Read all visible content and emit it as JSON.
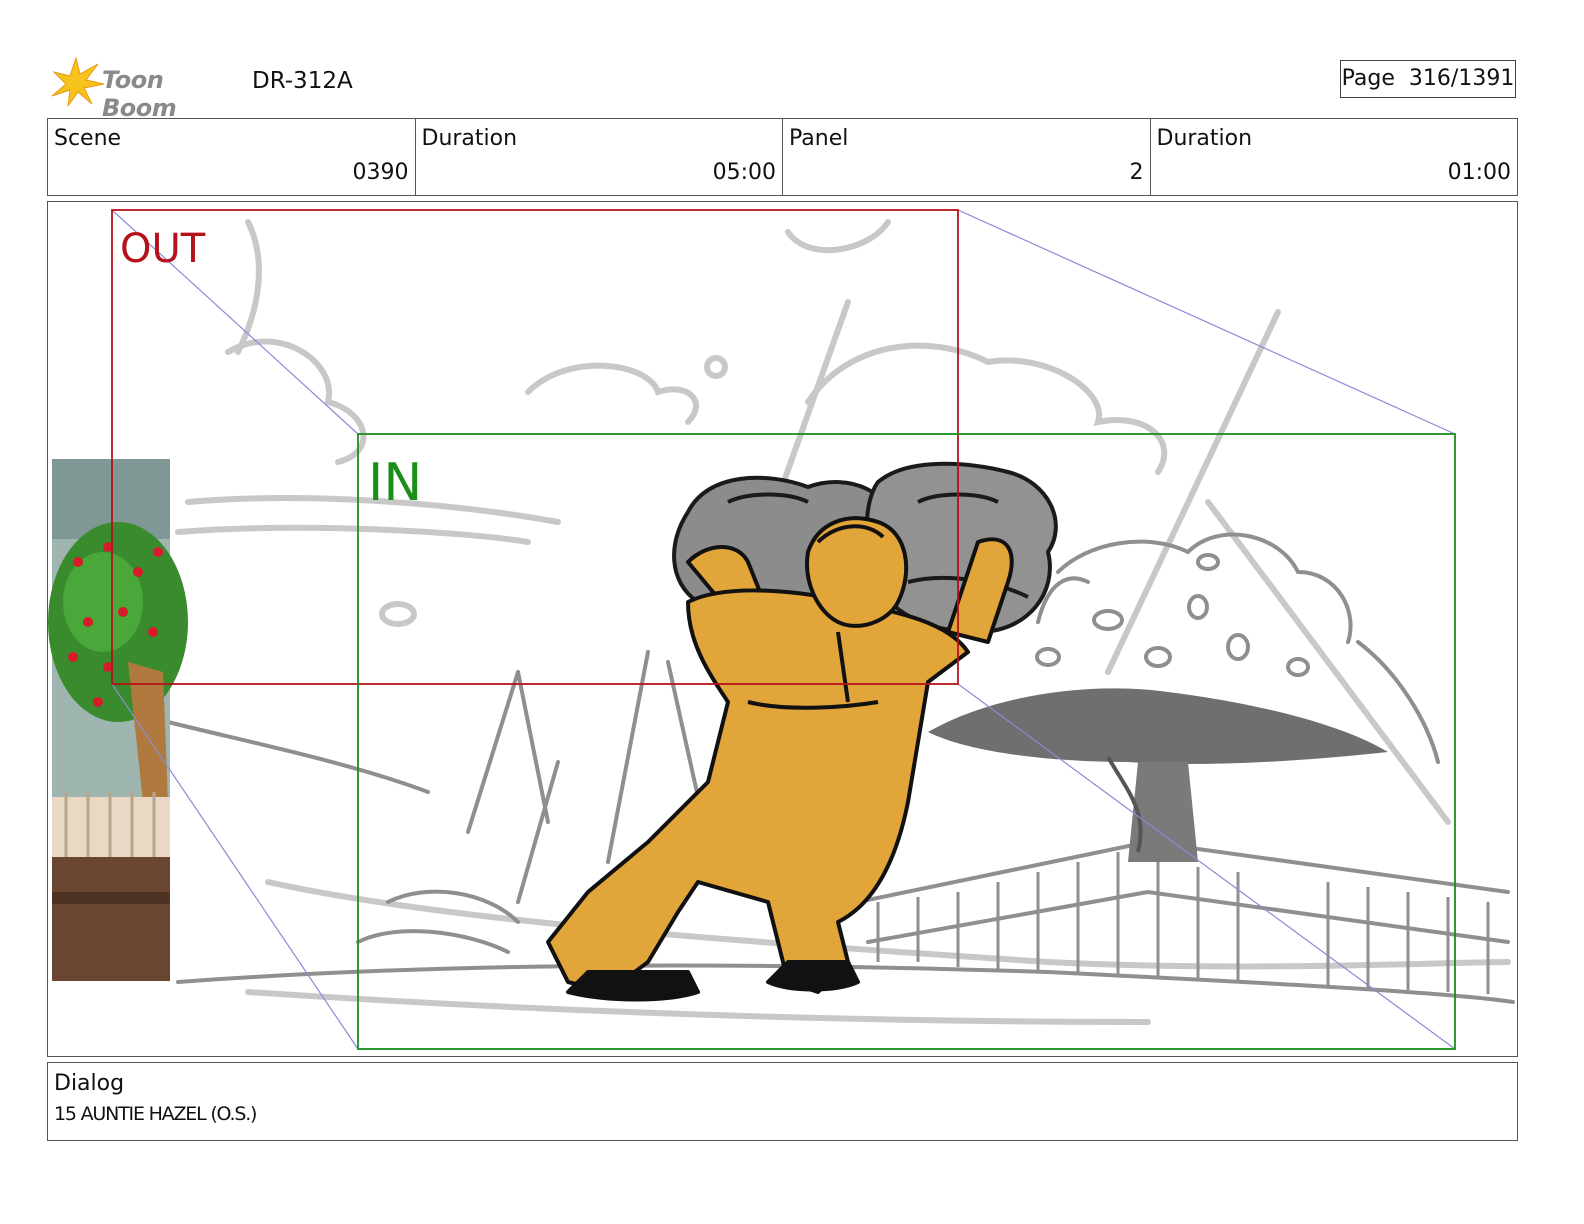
{
  "header": {
    "brand": "Toon Boom",
    "episode_code": "DR-312A",
    "page_label": "Page",
    "page_number": "316/1391"
  },
  "info": {
    "scene_label": "Scene",
    "scene_value": "0390",
    "scene_duration_label": "Duration",
    "scene_duration_value": "05:00",
    "panel_label": "Panel",
    "panel_value": "2",
    "panel_duration_label": "Duration",
    "panel_duration_value": "01:00"
  },
  "frame": {
    "out_label": "OUT",
    "in_label": "IN",
    "out_color": "#b5121b",
    "in_color": "#1a8f1a",
    "character_color": "#e2a53a",
    "rock_color": "#8c8c8c"
  },
  "dialog": {
    "label": "Dialog",
    "text": "15 AUNTIE HAZEL (O.S.)"
  }
}
